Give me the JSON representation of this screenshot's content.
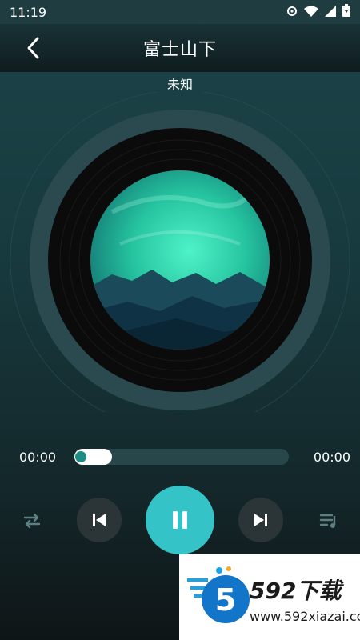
{
  "status": {
    "time": "11:19",
    "icons": [
      "settings-icon",
      "wifi-icon",
      "signal-icon",
      "battery-icon"
    ]
  },
  "header": {
    "title": "富士山下",
    "back_icon": "chevron-left-icon"
  },
  "song": {
    "artist": "未知"
  },
  "player": {
    "current_time": "00:00",
    "total_time": "00:00",
    "progress": 0.0
  },
  "controls": {
    "repeat_icon": "repeat-icon",
    "prev_icon": "skip-previous-icon",
    "play_icon": "pause-icon",
    "next_icon": "skip-next-icon",
    "playlist_icon": "playlist-icon"
  },
  "colors": {
    "accent": "#34c3c6",
    "progress_track": "#28474b",
    "knob": "#1c8c84"
  },
  "watermark": {
    "number": "5",
    "brand": "592下载",
    "url": "www.592xiazai.com"
  }
}
